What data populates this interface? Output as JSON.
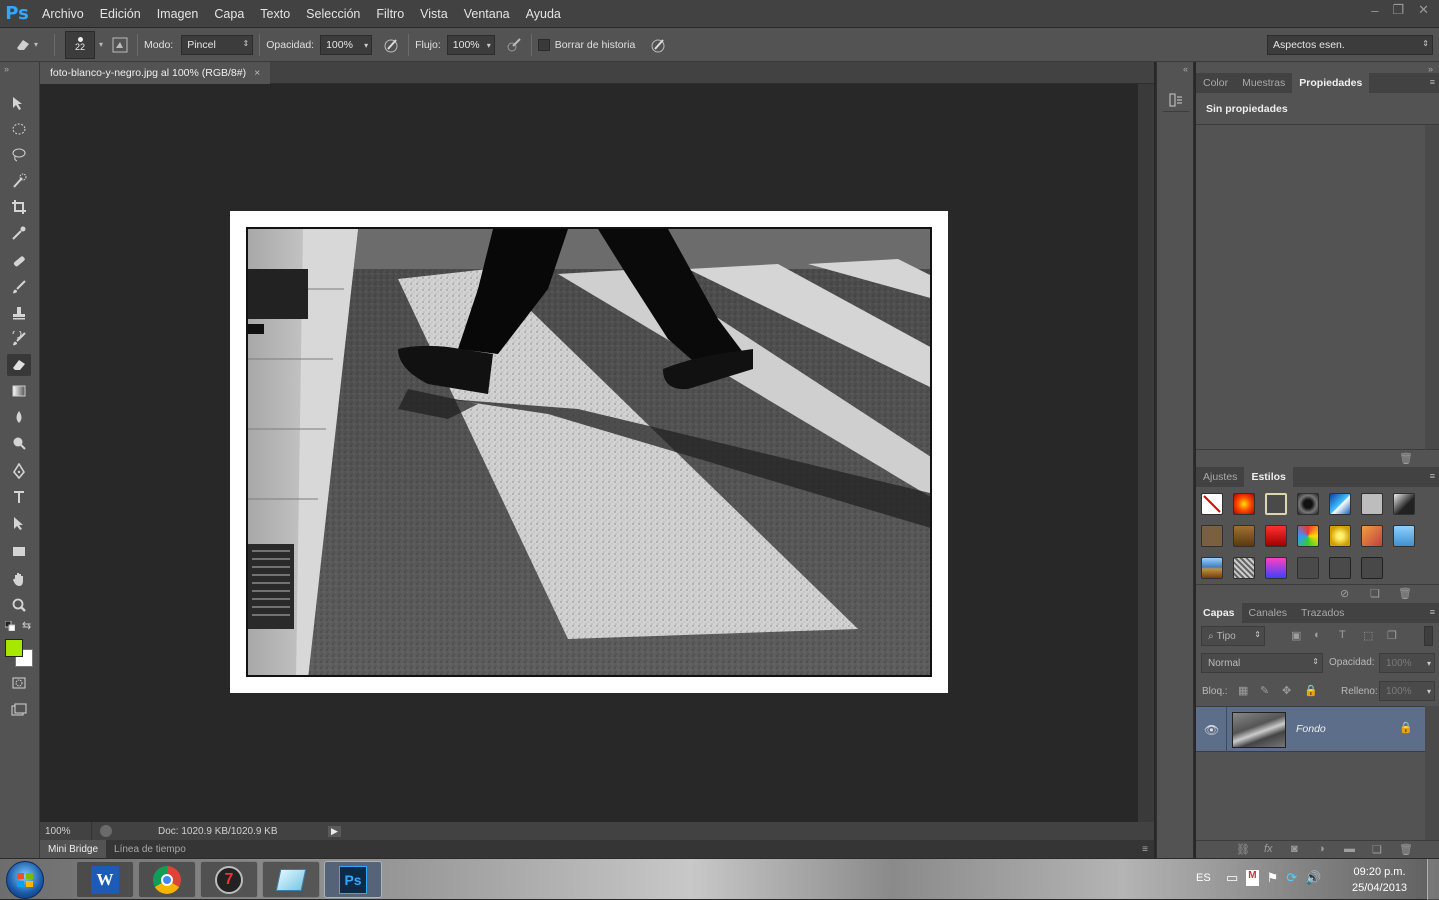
{
  "app": {
    "logo": "Ps"
  },
  "menubar": {
    "items": [
      "Archivo",
      "Edición",
      "Imagen",
      "Capa",
      "Texto",
      "Selección",
      "Filtro",
      "Vista",
      "Ventana",
      "Ayuda"
    ],
    "window_controls": {
      "minimize": "–",
      "restore": "❐",
      "close": "✕"
    }
  },
  "options": {
    "brush_size": "22",
    "modo_label": "Modo:",
    "modo_value": "Pincel",
    "opacidad_label": "Opacidad:",
    "opacidad_value": "100%",
    "flujo_label": "Flujo:",
    "flujo_value": "100%",
    "borrar_historia_label": "Borrar de historia",
    "borrar_historia_checked": false,
    "workspace_value": "Aspectos esen."
  },
  "document": {
    "tab_title": "foto-blanco-y-negro.jpg al 100% (RGB/8#)",
    "tab_close": "×",
    "zoom": "100%",
    "doc_info": "Doc: 1020.9 KB/1020.9 KB"
  },
  "bottom_tabs": [
    "Mini Bridge",
    "Línea de tiempo"
  ],
  "colors": {
    "foreground": "#a8e800",
    "background": "#ffffff"
  },
  "properties_panel": {
    "tabs": [
      "Color",
      "Muestras",
      "Propiedades"
    ],
    "active_tab": "Propiedades",
    "content": "Sin propiedades"
  },
  "styles_panel": {
    "tabs": [
      "Ajustes",
      "Estilos"
    ],
    "active_tab": "Estilos"
  },
  "layers_panel": {
    "tabs": [
      "Capas",
      "Canales",
      "Trazados"
    ],
    "active_tab": "Capas",
    "filter_value": "Tipo",
    "blend_mode": "Normal",
    "opacity_label": "Opacidad:",
    "opacity_value": "100%",
    "lock_label": "Bloq.:",
    "fill_label": "Relleno:",
    "fill_value": "100%",
    "layers": [
      {
        "name": "Fondo",
        "visible": true,
        "locked": true
      }
    ]
  },
  "taskbar": {
    "language": "ES",
    "time": "09:20 p.m.",
    "date": "25/04/2013"
  }
}
